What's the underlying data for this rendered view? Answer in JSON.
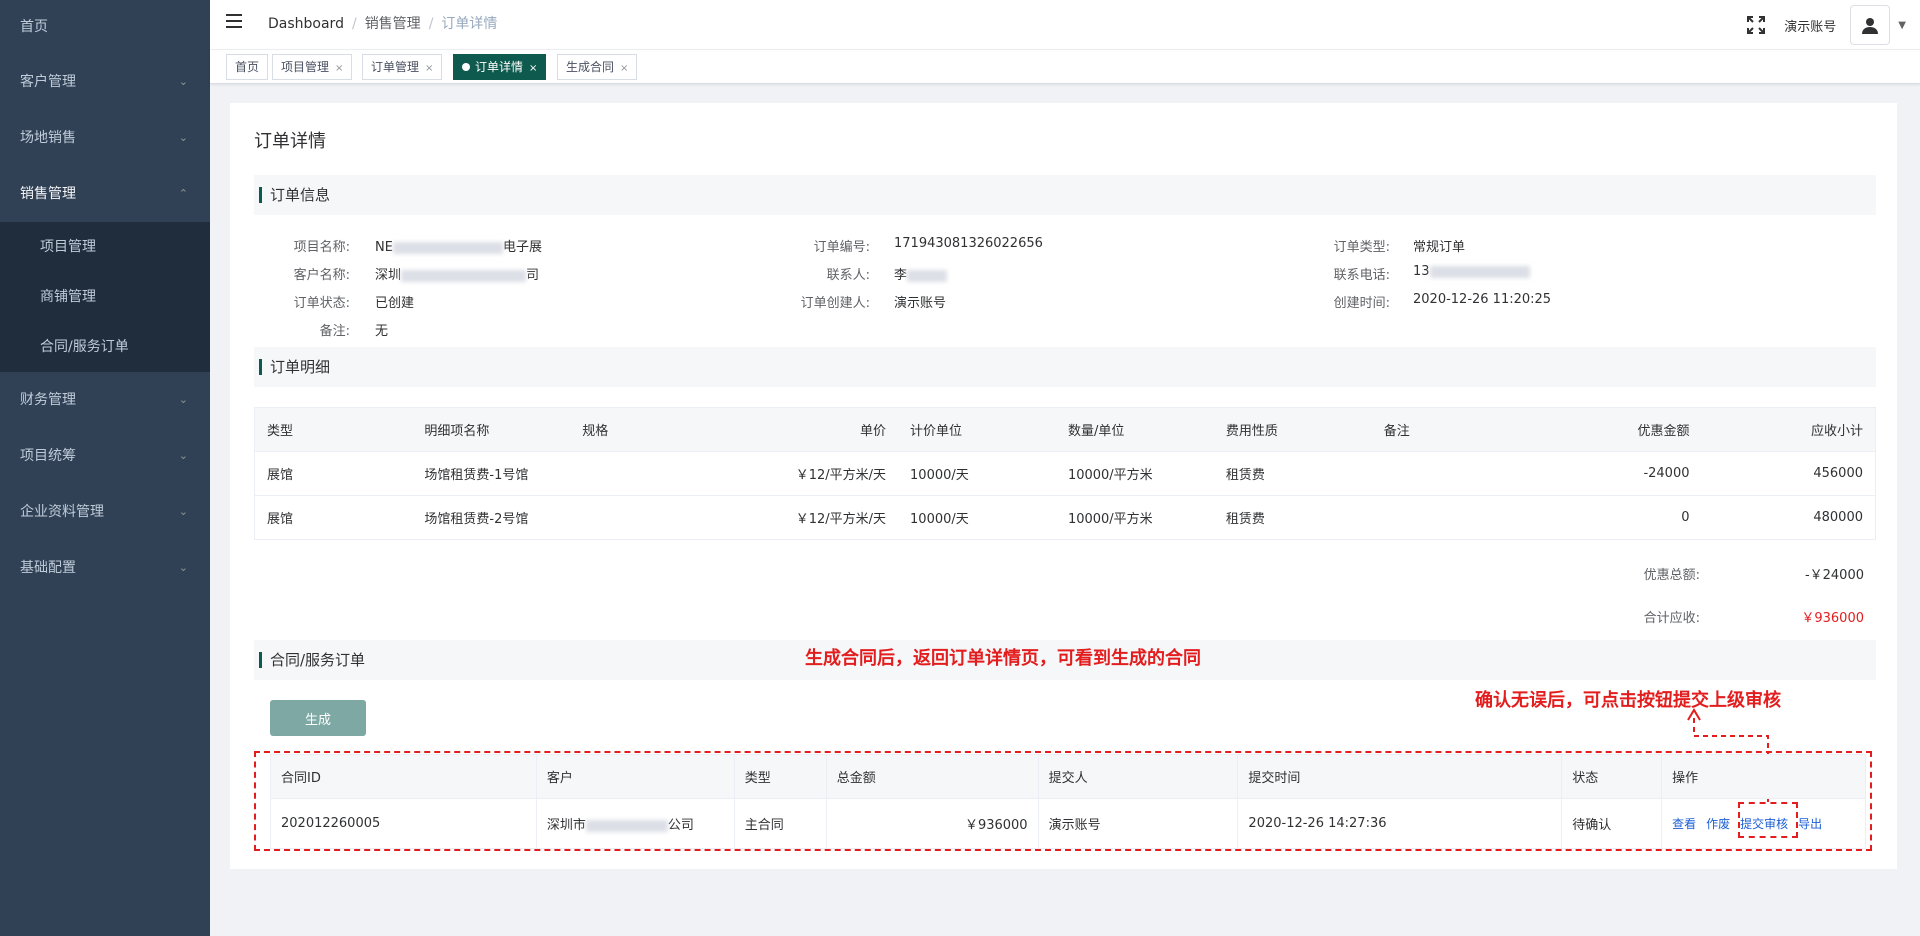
{
  "sidebar": {
    "items": [
      {
        "label": "首页"
      },
      {
        "label": "客户管理"
      },
      {
        "label": "场地销售"
      },
      {
        "label": "销售管理"
      },
      {
        "label": "财务管理"
      },
      {
        "label": "项目统筹"
      },
      {
        "label": "企业资料管理"
      },
      {
        "label": "基础配置"
      }
    ],
    "sales_sub": [
      {
        "label": "项目管理"
      },
      {
        "label": "商铺管理"
      },
      {
        "label": "合同/服务订单"
      }
    ]
  },
  "header": {
    "breadcrumb": [
      "Dashboard",
      "销售管理",
      "订单详情"
    ],
    "username": "演示账号"
  },
  "tags": [
    {
      "label": "首页"
    },
    {
      "label": "项目管理"
    },
    {
      "label": "订单管理"
    },
    {
      "label": "订单详情"
    },
    {
      "label": "生成合同"
    }
  ],
  "page": {
    "title": "订单详情",
    "section_info": "订单信息",
    "section_detail": "订单明细",
    "section_contract": "合同/服务订单"
  },
  "order_info": {
    "labels": {
      "project_name": "项目名称:",
      "customer_name": "客户名称:",
      "status": "订单状态:",
      "remark": "备注:",
      "order_no": "订单编号:",
      "contact": "联系人:",
      "creator": "订单创建人:",
      "order_type": "订单类型:",
      "phone": "联系电话:",
      "created_at": "创建时间:"
    },
    "values": {
      "project_name_prefix": "NE",
      "project_name_suffix": "电子展",
      "customer_name_prefix": "深圳",
      "customer_name_suffix": "司",
      "status": "已创建",
      "remark": "无",
      "order_no": "171943081326022656",
      "contact": "李",
      "creator": "演示账号",
      "order_type": "常规订单",
      "phone": "13",
      "created_at": "2020-12-26 11:20:25"
    }
  },
  "detail_table": {
    "headers": [
      "类型",
      "明细项名称",
      "规格",
      "单价",
      "计价单位",
      "数量/单位",
      "费用性质",
      "备注",
      "优惠金额",
      "应收小计"
    ],
    "rows": [
      [
        "展馆",
        "场馆租赁费-1号馆",
        "",
        "￥12/平方米/天",
        "10000/天",
        "10000/平方米",
        "租赁费",
        "",
        "-24000",
        "456000"
      ],
      [
        "展馆",
        "场馆租赁费-2号馆",
        "",
        "￥12/平方米/天",
        "10000/天",
        "10000/平方米",
        "租赁费",
        "",
        "0",
        "480000"
      ]
    ]
  },
  "summary": {
    "discount_label": "优惠总额:",
    "discount_value": "-￥24000",
    "total_label": "合计应收:",
    "total_value": "￥936000"
  },
  "contract": {
    "generate_label": "生成",
    "headers": [
      "合同ID",
      "客户",
      "类型",
      "总金额",
      "提交人",
      "提交时间",
      "状态",
      "操作"
    ],
    "row": {
      "id": "202012260005",
      "customer_prefix": "深圳市",
      "customer_suffix": "公司",
      "type": "主合同",
      "amount": "￥936000",
      "submitter": "演示账号",
      "submit_time": "2020-12-26 14:27:36",
      "status": "待确认",
      "ops": [
        "查看",
        "作废",
        "提交审核",
        "导出"
      ]
    }
  },
  "annotations": {
    "note1": "生成合同后，返回订单详情页，可看到生成的合同",
    "note2": "确认无误后，可点击按钮提交上级审核"
  },
  "colors": {
    "sidebar_bg": "#304156",
    "accent": "#0f5a4e",
    "annotation": "#e31d1d",
    "total_red": "#e31d1d",
    "link": "#1c5fd3"
  }
}
